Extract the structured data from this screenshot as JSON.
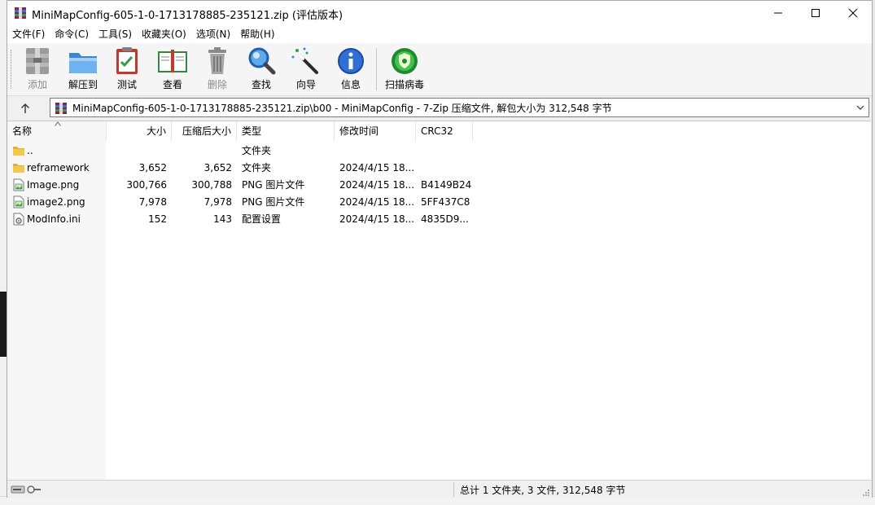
{
  "window": {
    "title": "MiniMapConfig-605-1-0-1713178885-235121.zip (评估版本)"
  },
  "menu": [
    "文件(F)",
    "命令(C)",
    "工具(S)",
    "收藏夹(O)",
    "选项(N)",
    "帮助(H)"
  ],
  "toolbar": {
    "buttons": [
      {
        "label": "添加",
        "icon": "add-archive-icon",
        "enabled": false
      },
      {
        "label": "解压到",
        "icon": "extract-folder-icon",
        "enabled": true
      },
      {
        "label": "测试",
        "icon": "test-clipboard-icon",
        "enabled": true
      },
      {
        "label": "查看",
        "icon": "view-book-icon",
        "enabled": true
      },
      {
        "label": "删除",
        "icon": "trash-icon",
        "enabled": false
      },
      {
        "label": "查找",
        "icon": "magnifier-icon",
        "enabled": true
      },
      {
        "label": "向导",
        "icon": "wizard-wand-icon",
        "enabled": true
      },
      {
        "label": "信息",
        "icon": "info-icon",
        "enabled": true
      },
      {
        "label": "扫描病毒",
        "icon": "virus-scan-icon",
        "enabled": true
      }
    ]
  },
  "address": {
    "path": "MiniMapConfig-605-1-0-1713178885-235121.zip\\b00 - MiniMapConfig - 7-Zip 压缩文件, 解包大小为 312,548 字节"
  },
  "columns": {
    "name": "名称",
    "size": "大小",
    "packed": "压缩后大小",
    "type": "类型",
    "modified": "修改时间",
    "crc": "CRC32"
  },
  "files": [
    {
      "name": "..",
      "size": "",
      "packed": "",
      "type": "文件夹",
      "modified": "",
      "crc": "",
      "icon": "folder-icon"
    },
    {
      "name": "reframework",
      "size": "3,652",
      "packed": "3,652",
      "type": "文件夹",
      "modified": "2024/4/15 18...",
      "crc": "",
      "icon": "folder-icon"
    },
    {
      "name": "Image.png",
      "size": "300,766",
      "packed": "300,788",
      "type": "PNG 图片文件",
      "modified": "2024/4/15 18...",
      "crc": "B4149B24",
      "icon": "image-file-icon"
    },
    {
      "name": "image2.png",
      "size": "7,978",
      "packed": "7,978",
      "type": "PNG 图片文件",
      "modified": "2024/4/15 18...",
      "crc": "5FF437C8",
      "icon": "image-file-icon"
    },
    {
      "name": "ModInfo.ini",
      "size": "152",
      "packed": "143",
      "type": "配置设置",
      "modified": "2024/4/15 18...",
      "crc": "4835D9...",
      "icon": "ini-file-icon"
    }
  ],
  "status": {
    "summary": "总计 1 文件夹, 3 文件, 312,548 字节"
  },
  "colors": {
    "folder": "#f2c94c",
    "accent_blue": "#2f6fd6",
    "disabled_text": "#8a8a8a"
  }
}
